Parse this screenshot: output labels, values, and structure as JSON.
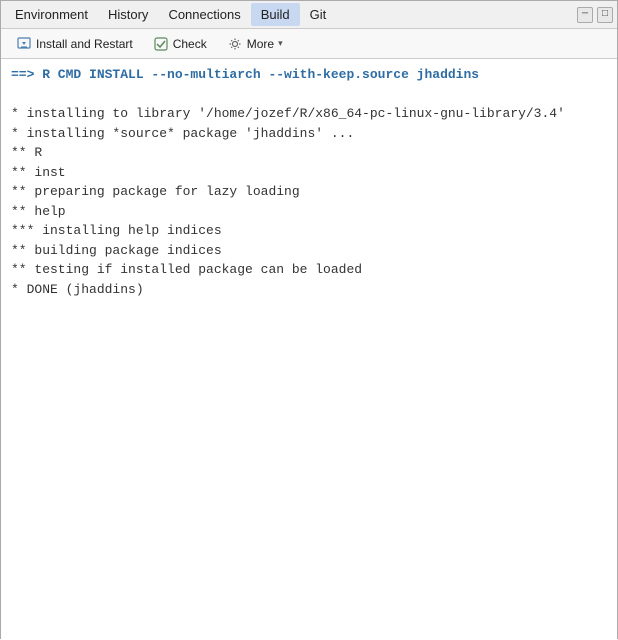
{
  "menubar": {
    "items": [
      {
        "label": "Environment",
        "id": "environment"
      },
      {
        "label": "History",
        "id": "history",
        "active": false
      },
      {
        "label": "Connections",
        "id": "connections"
      },
      {
        "label": "Build",
        "id": "build",
        "active": true
      },
      {
        "label": "Git",
        "id": "git"
      }
    ],
    "minimize_label": "─",
    "maximize_label": "□"
  },
  "toolbar": {
    "install_label": "Install and Restart",
    "check_label": "Check",
    "more_label": "More",
    "more_arrow": "▾"
  },
  "console": {
    "lines": [
      {
        "type": "cmd",
        "text": "==> R CMD INSTALL --no-multiarch --with-keep.source jhaddins"
      },
      {
        "type": "normal",
        "text": ""
      },
      {
        "type": "normal",
        "text": "* installing to library '/home/jozef/R/x86_64-pc-linux-gnu-library/3.4'"
      },
      {
        "type": "normal",
        "text": "* installing *source* package 'jhaddins' ..."
      },
      {
        "type": "normal",
        "text": "** R"
      },
      {
        "type": "normal",
        "text": "** inst"
      },
      {
        "type": "normal",
        "text": "** preparing package for lazy loading"
      },
      {
        "type": "normal",
        "text": "** help"
      },
      {
        "type": "normal",
        "text": "*** installing help indices"
      },
      {
        "type": "normal",
        "text": "** building package indices"
      },
      {
        "type": "normal",
        "text": "** testing if installed package can be loaded"
      },
      {
        "type": "normal",
        "text": "* DONE (jhaddins)"
      }
    ]
  }
}
